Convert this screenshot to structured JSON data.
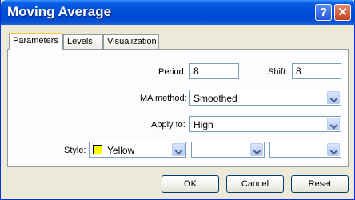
{
  "window": {
    "title": "Moving Average",
    "help_glyph": "?",
    "close_glyph": "✕"
  },
  "tabs": [
    {
      "label": "Parameters",
      "active": true
    },
    {
      "label": "Levels",
      "active": false
    },
    {
      "label": "Visualization",
      "active": false
    }
  ],
  "params": {
    "period_label": "Period:",
    "period_value": "8",
    "shift_label": "Shift:",
    "shift_value": "8",
    "ma_method_label": "MA method:",
    "ma_method_value": "Smoothed",
    "apply_to_label": "Apply to:",
    "apply_to_value": "High",
    "style_label": "Style:",
    "style_color_name": "Yellow",
    "style_color_hex": "#ffff00"
  },
  "buttons": {
    "ok": "OK",
    "cancel": "Cancel",
    "reset": "Reset"
  }
}
